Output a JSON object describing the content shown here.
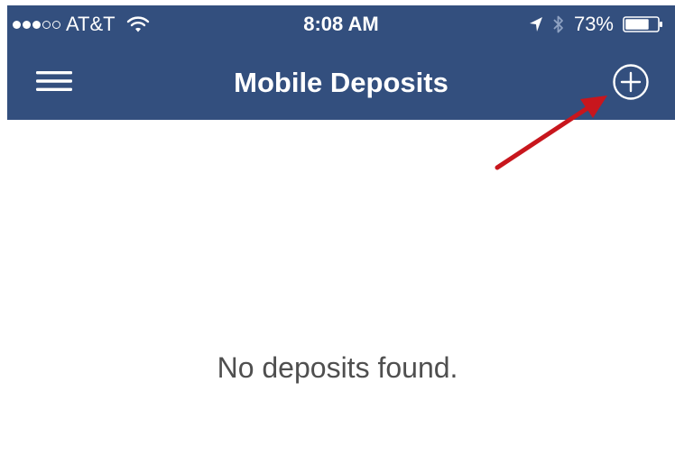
{
  "status_bar": {
    "carrier": "AT&T",
    "signal_bars_filled": 3,
    "signal_bars_total": 5,
    "time": "8:08 AM",
    "battery_percent": "73%",
    "icons": [
      "signal-dots-icon",
      "wifi-icon",
      "location-arrow-icon",
      "bluetooth-icon",
      "battery-icon"
    ]
  },
  "nav": {
    "title": "Mobile Deposits",
    "menu_icon": "hamburger-menu-icon",
    "add_icon": "plus-circle-icon"
  },
  "content": {
    "empty_message": "No deposits found."
  },
  "annotation": {
    "color": "#c8161d",
    "icon": "red-arrow-pointer"
  },
  "colors": {
    "header_background": "#334f7e",
    "header_text": "#ffffff",
    "body_background": "#ffffff",
    "empty_text": "#4f4f4f"
  }
}
